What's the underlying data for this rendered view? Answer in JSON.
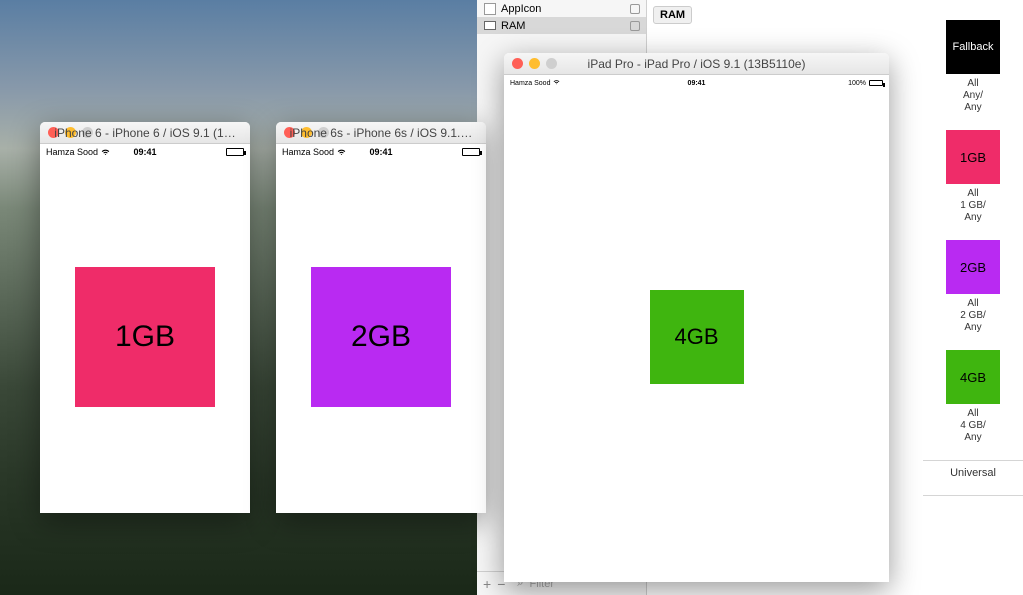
{
  "xcode": {
    "sidebar": {
      "items": [
        {
          "label": "AppIcon"
        },
        {
          "label": "RAM"
        }
      ]
    },
    "footer": {
      "plus": "+",
      "minus": "−",
      "filter_placeholder": "Filter"
    },
    "ram_tag": "RAM",
    "assets": [
      {
        "thumb_label": "Fallback",
        "class": "fallback",
        "caption": "All\nAny/\nAny"
      },
      {
        "thumb_label": "1GB",
        "class": "g1",
        "caption": "All\n1 GB/\nAny"
      },
      {
        "thumb_label": "2GB",
        "class": "g2",
        "caption": "All\n2 GB/\nAny"
      },
      {
        "thumb_label": "4GB",
        "class": "g4",
        "caption": "All\n4 GB/\nAny"
      }
    ],
    "universal": "Universal"
  },
  "simulators": {
    "iphone6": {
      "title": "iPhone 6 - iPhone 6 / iOS 9.1 (1…",
      "carrier": "Hamza Sood",
      "time": "09:41",
      "square_label": "1GB",
      "square_color": "#ef2c69"
    },
    "iphone6s": {
      "title": "iPhone 6s - iPhone 6s / iOS 9.1.…",
      "carrier": "Hamza Sood",
      "time": "09:41",
      "square_label": "2GB",
      "square_color": "#b92af2"
    },
    "ipadpro": {
      "title": "iPad Pro - iPad Pro / iOS 9.1 (13B5110e)",
      "carrier": "Hamza Sood",
      "time": "09:41",
      "battery": "100%",
      "square_label": "4GB",
      "square_color": "#3fb50f"
    }
  }
}
